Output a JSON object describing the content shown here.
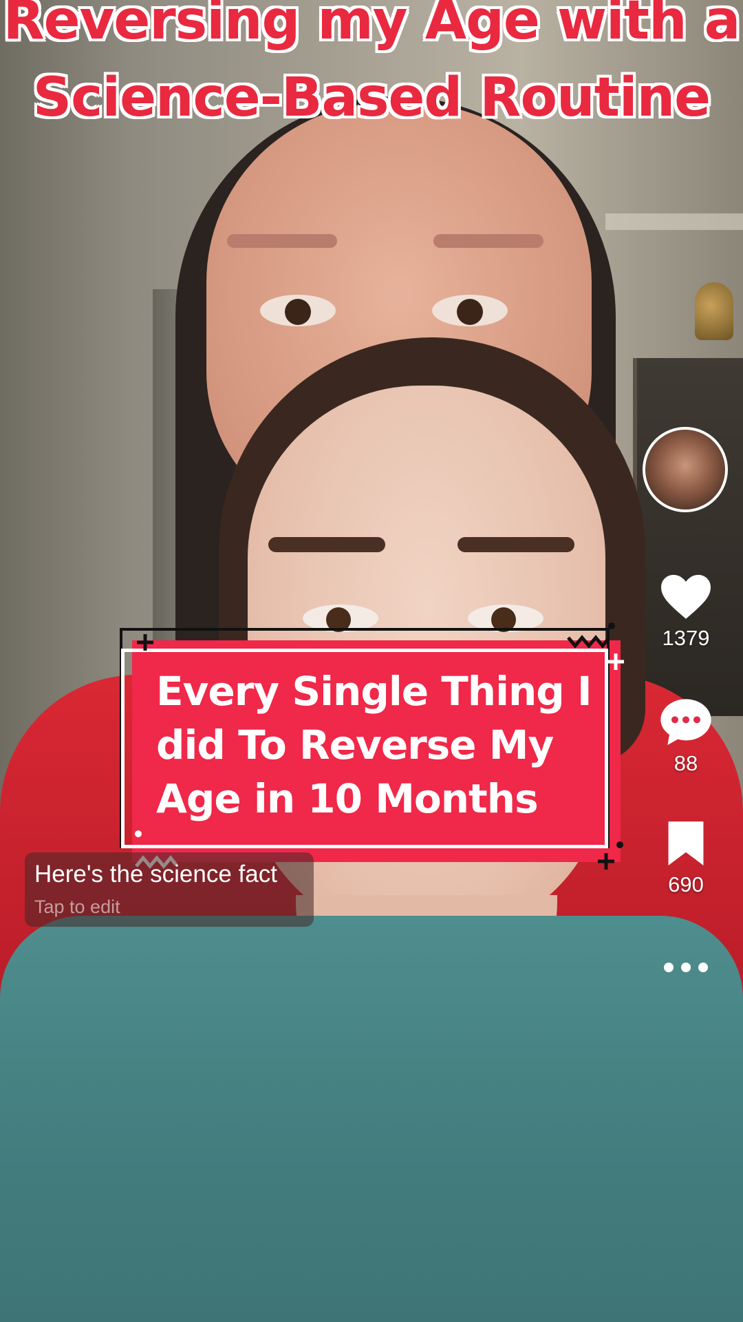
{
  "video": {
    "title_lines": [
      "Reversing my Age with a",
      "Science-Based Routine"
    ],
    "sticker_text": "Every Single Thing I did To Reverse My Age in 10 Months",
    "caption_text": "Here's the science fact",
    "caption_hint": "Tap to edit"
  },
  "actions": {
    "likes": "1379",
    "comments": "88",
    "saves": "690"
  },
  "icons": {
    "like": "heart-icon",
    "comment": "comment-bubble-icon",
    "save": "bookmark-icon",
    "more": "more-dots-icon"
  },
  "colors": {
    "title_red": "#e8293f",
    "sticker_red": "#f02849",
    "icon_white": "#ffffff"
  }
}
